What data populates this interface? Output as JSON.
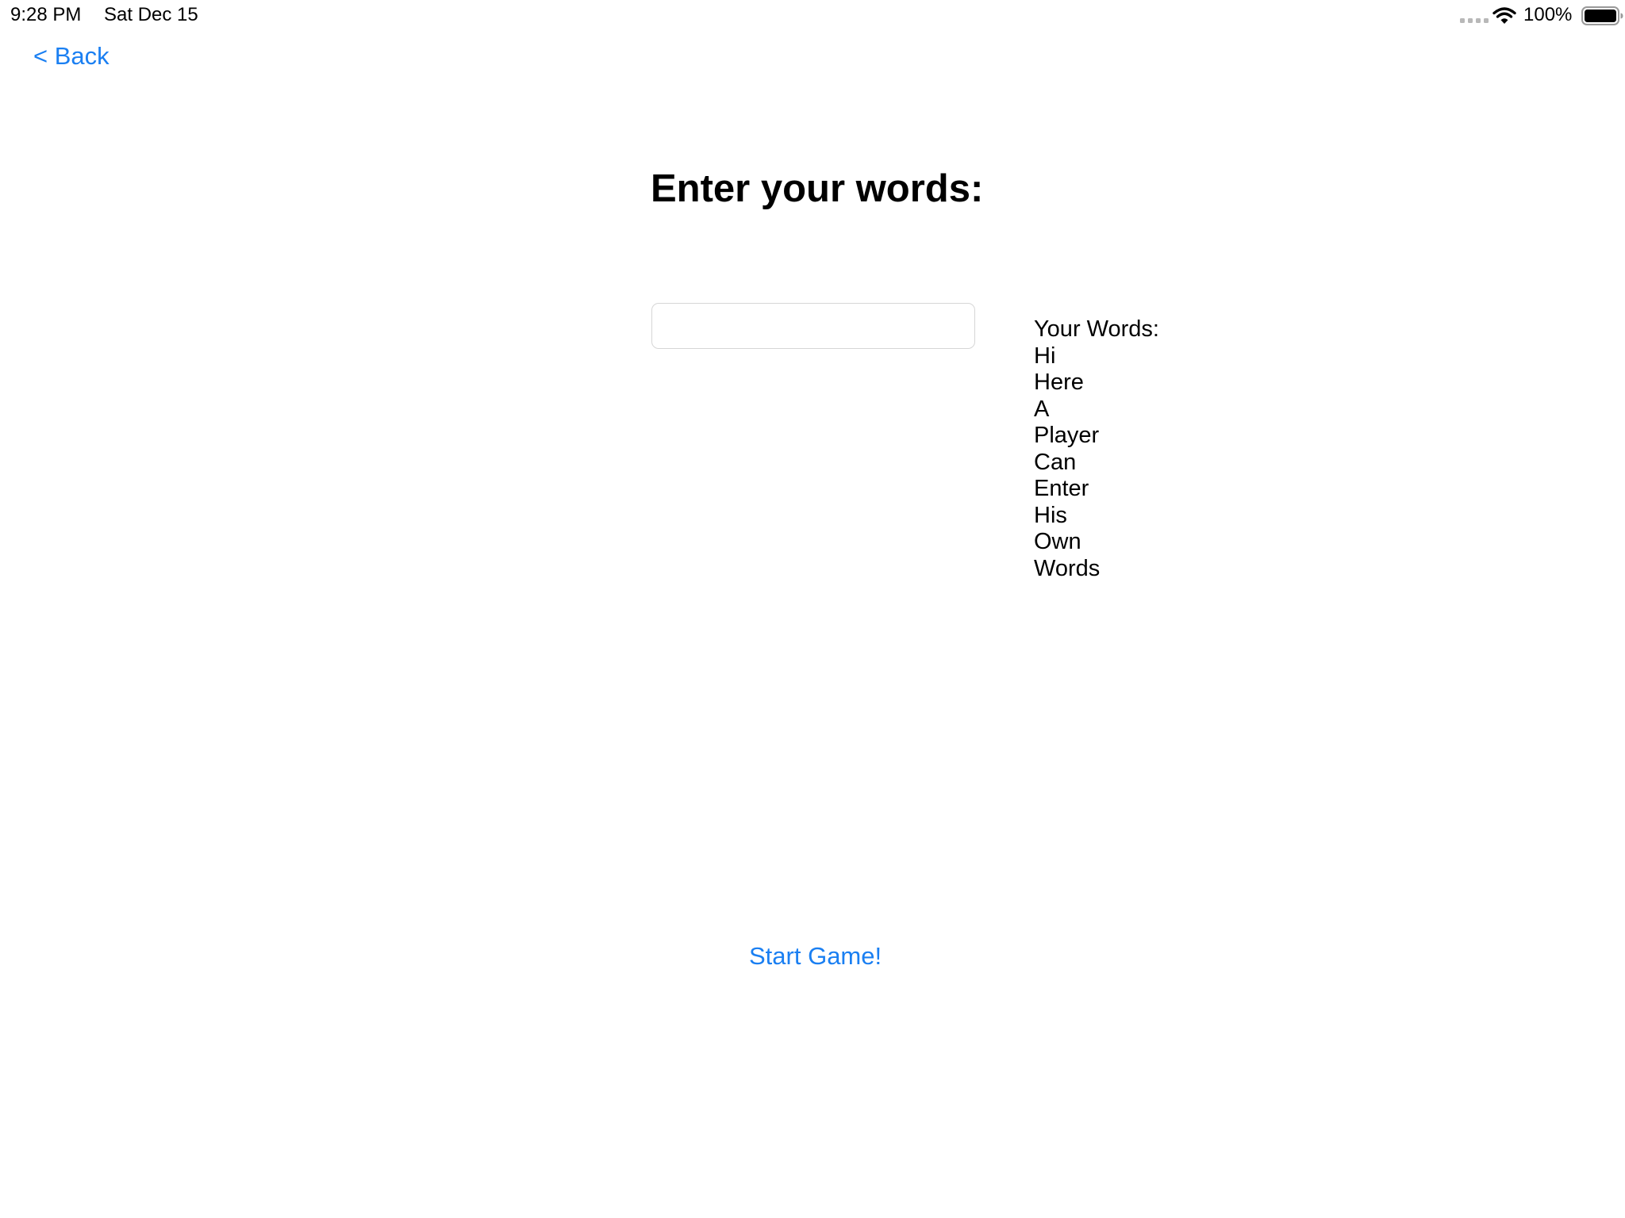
{
  "status_bar": {
    "time": "9:28 PM",
    "date": "Sat Dec 15",
    "battery_percent": "100%",
    "icons": [
      "signal-dots-icon",
      "wifi-icon",
      "battery-icon"
    ]
  },
  "nav": {
    "back_label": "< Back"
  },
  "main": {
    "title": "Enter your words:",
    "input_value": "",
    "words_header": "Your Words:",
    "words": [
      "Hi",
      "Here",
      "A",
      "Player",
      "Can",
      "Enter",
      "His",
      "Own",
      "Words"
    ],
    "start_label": "Start Game!"
  },
  "colors": {
    "accent": "#1a7ff2",
    "text": "#000000",
    "background": "#ffffff",
    "input_border": "#d6d6d6"
  }
}
